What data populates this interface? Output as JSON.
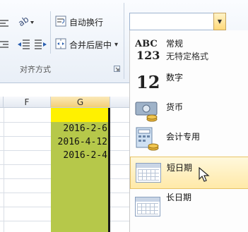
{
  "ribbon": {
    "wrap_text": "自动换行",
    "merge_center": "合并后居中",
    "group_alignment": "对齐方式",
    "merge_arrow": "▾"
  },
  "number_format": {
    "value": ""
  },
  "sheet": {
    "columns": [
      "F",
      "G"
    ],
    "cells_g": [
      "2016-2-6",
      "2016-4-12",
      "2016-2-4"
    ]
  },
  "menu": {
    "items": [
      {
        "icon": "abc-123-icon",
        "title": "常规",
        "subtitle": "无特定格式"
      },
      {
        "icon": "number-12-icon",
        "title": "数字"
      },
      {
        "icon": "currency-icon",
        "title": "货币"
      },
      {
        "icon": "accounting-icon",
        "title": "会计专用"
      },
      {
        "icon": "calendar-icon",
        "title": "短日期",
        "selected": true
      },
      {
        "icon": "calendar-icon",
        "title": "长日期"
      }
    ]
  },
  "colors": {
    "selected_column_fill": "#b6c84a",
    "active_cell_fill": "#fff100",
    "highlight": "#ffe9a8"
  }
}
